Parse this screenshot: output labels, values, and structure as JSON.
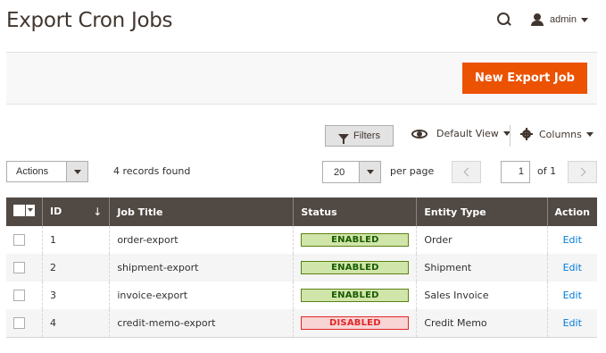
{
  "header": {
    "title": "Export Cron Jobs",
    "user_label": "admin"
  },
  "action_bar": {
    "new_job_label": "New Export Job"
  },
  "toolbar": {
    "filters_label": "Filters",
    "view_label": "Default View",
    "columns_label": "Columns",
    "actions_label": "Actions",
    "records_found": "4 records found",
    "per_page_value": "20",
    "per_page_label": "per page",
    "page_value": "1",
    "page_of": "of 1"
  },
  "grid": {
    "columns": [
      "ID",
      "Job Title",
      "Status",
      "Entity Type",
      "Action"
    ],
    "sort_indicator": "↓",
    "rows": [
      {
        "id": "1",
        "title": "order-export",
        "status": "ENABLED",
        "entity": "Order",
        "action": "Edit"
      },
      {
        "id": "2",
        "title": "shipment-export",
        "status": "ENABLED",
        "entity": "Shipment",
        "action": "Edit"
      },
      {
        "id": "3",
        "title": "invoice-export",
        "status": "ENABLED",
        "entity": "Sales Invoice",
        "action": "Edit"
      },
      {
        "id": "4",
        "title": "credit-memo-export",
        "status": "DISABLED",
        "entity": "Credit Memo",
        "action": "Edit"
      }
    ]
  },
  "colors": {
    "accent": "#eb5202",
    "header_bg": "#514943",
    "enabled_bg": "#d0e5a9",
    "disabled_bg": "#f9d4d4",
    "link": "#007bdb"
  }
}
